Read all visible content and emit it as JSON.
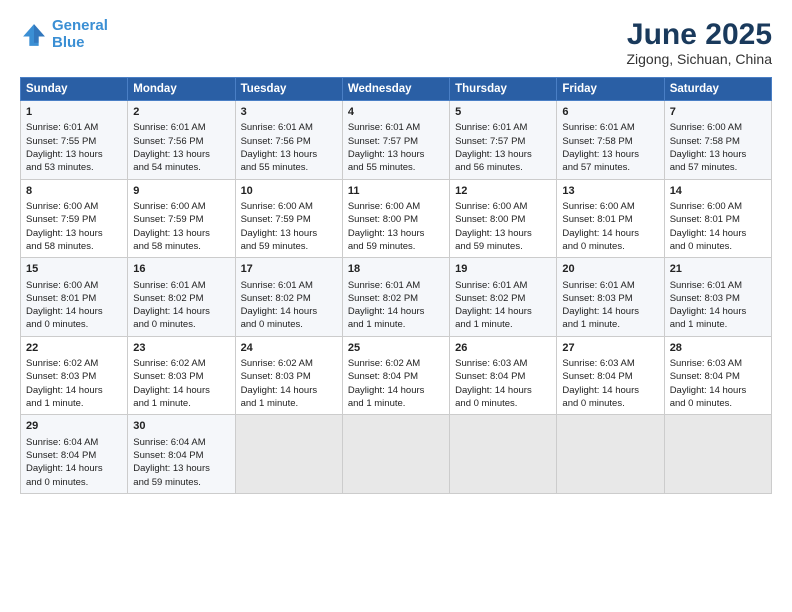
{
  "header": {
    "logo_line1": "General",
    "logo_line2": "Blue",
    "title": "June 2025",
    "subtitle": "Zigong, Sichuan, China"
  },
  "columns": [
    "Sunday",
    "Monday",
    "Tuesday",
    "Wednesday",
    "Thursday",
    "Friday",
    "Saturday"
  ],
  "rows": [
    [
      {
        "day": "1",
        "lines": [
          "Sunrise: 6:01 AM",
          "Sunset: 7:55 PM",
          "Daylight: 13 hours",
          "and 53 minutes."
        ]
      },
      {
        "day": "2",
        "lines": [
          "Sunrise: 6:01 AM",
          "Sunset: 7:56 PM",
          "Daylight: 13 hours",
          "and 54 minutes."
        ]
      },
      {
        "day": "3",
        "lines": [
          "Sunrise: 6:01 AM",
          "Sunset: 7:56 PM",
          "Daylight: 13 hours",
          "and 55 minutes."
        ]
      },
      {
        "day": "4",
        "lines": [
          "Sunrise: 6:01 AM",
          "Sunset: 7:57 PM",
          "Daylight: 13 hours",
          "and 55 minutes."
        ]
      },
      {
        "day": "5",
        "lines": [
          "Sunrise: 6:01 AM",
          "Sunset: 7:57 PM",
          "Daylight: 13 hours",
          "and 56 minutes."
        ]
      },
      {
        "day": "6",
        "lines": [
          "Sunrise: 6:01 AM",
          "Sunset: 7:58 PM",
          "Daylight: 13 hours",
          "and 57 minutes."
        ]
      },
      {
        "day": "7",
        "lines": [
          "Sunrise: 6:00 AM",
          "Sunset: 7:58 PM",
          "Daylight: 13 hours",
          "and 57 minutes."
        ]
      }
    ],
    [
      {
        "day": "8",
        "lines": [
          "Sunrise: 6:00 AM",
          "Sunset: 7:59 PM",
          "Daylight: 13 hours",
          "and 58 minutes."
        ]
      },
      {
        "day": "9",
        "lines": [
          "Sunrise: 6:00 AM",
          "Sunset: 7:59 PM",
          "Daylight: 13 hours",
          "and 58 minutes."
        ]
      },
      {
        "day": "10",
        "lines": [
          "Sunrise: 6:00 AM",
          "Sunset: 7:59 PM",
          "Daylight: 13 hours",
          "and 59 minutes."
        ]
      },
      {
        "day": "11",
        "lines": [
          "Sunrise: 6:00 AM",
          "Sunset: 8:00 PM",
          "Daylight: 13 hours",
          "and 59 minutes."
        ]
      },
      {
        "day": "12",
        "lines": [
          "Sunrise: 6:00 AM",
          "Sunset: 8:00 PM",
          "Daylight: 13 hours",
          "and 59 minutes."
        ]
      },
      {
        "day": "13",
        "lines": [
          "Sunrise: 6:00 AM",
          "Sunset: 8:01 PM",
          "Daylight: 14 hours",
          "and 0 minutes."
        ]
      },
      {
        "day": "14",
        "lines": [
          "Sunrise: 6:00 AM",
          "Sunset: 8:01 PM",
          "Daylight: 14 hours",
          "and 0 minutes."
        ]
      }
    ],
    [
      {
        "day": "15",
        "lines": [
          "Sunrise: 6:00 AM",
          "Sunset: 8:01 PM",
          "Daylight: 14 hours",
          "and 0 minutes."
        ]
      },
      {
        "day": "16",
        "lines": [
          "Sunrise: 6:01 AM",
          "Sunset: 8:02 PM",
          "Daylight: 14 hours",
          "and 0 minutes."
        ]
      },
      {
        "day": "17",
        "lines": [
          "Sunrise: 6:01 AM",
          "Sunset: 8:02 PM",
          "Daylight: 14 hours",
          "and 0 minutes."
        ]
      },
      {
        "day": "18",
        "lines": [
          "Sunrise: 6:01 AM",
          "Sunset: 8:02 PM",
          "Daylight: 14 hours",
          "and 1 minute."
        ]
      },
      {
        "day": "19",
        "lines": [
          "Sunrise: 6:01 AM",
          "Sunset: 8:02 PM",
          "Daylight: 14 hours",
          "and 1 minute."
        ]
      },
      {
        "day": "20",
        "lines": [
          "Sunrise: 6:01 AM",
          "Sunset: 8:03 PM",
          "Daylight: 14 hours",
          "and 1 minute."
        ]
      },
      {
        "day": "21",
        "lines": [
          "Sunrise: 6:01 AM",
          "Sunset: 8:03 PM",
          "Daylight: 14 hours",
          "and 1 minute."
        ]
      }
    ],
    [
      {
        "day": "22",
        "lines": [
          "Sunrise: 6:02 AM",
          "Sunset: 8:03 PM",
          "Daylight: 14 hours",
          "and 1 minute."
        ]
      },
      {
        "day": "23",
        "lines": [
          "Sunrise: 6:02 AM",
          "Sunset: 8:03 PM",
          "Daylight: 14 hours",
          "and 1 minute."
        ]
      },
      {
        "day": "24",
        "lines": [
          "Sunrise: 6:02 AM",
          "Sunset: 8:03 PM",
          "Daylight: 14 hours",
          "and 1 minute."
        ]
      },
      {
        "day": "25",
        "lines": [
          "Sunrise: 6:02 AM",
          "Sunset: 8:04 PM",
          "Daylight: 14 hours",
          "and 1 minute."
        ]
      },
      {
        "day": "26",
        "lines": [
          "Sunrise: 6:03 AM",
          "Sunset: 8:04 PM",
          "Daylight: 14 hours",
          "and 0 minutes."
        ]
      },
      {
        "day": "27",
        "lines": [
          "Sunrise: 6:03 AM",
          "Sunset: 8:04 PM",
          "Daylight: 14 hours",
          "and 0 minutes."
        ]
      },
      {
        "day": "28",
        "lines": [
          "Sunrise: 6:03 AM",
          "Sunset: 8:04 PM",
          "Daylight: 14 hours",
          "and 0 minutes."
        ]
      }
    ],
    [
      {
        "day": "29",
        "lines": [
          "Sunrise: 6:04 AM",
          "Sunset: 8:04 PM",
          "Daylight: 14 hours",
          "and 0 minutes."
        ]
      },
      {
        "day": "30",
        "lines": [
          "Sunrise: 6:04 AM",
          "Sunset: 8:04 PM",
          "Daylight: 13 hours",
          "and 59 minutes."
        ]
      },
      null,
      null,
      null,
      null,
      null
    ]
  ]
}
